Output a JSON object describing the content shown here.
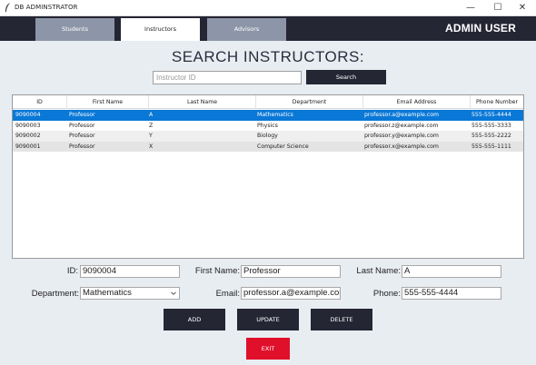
{
  "window": {
    "title": "DB ADMINSTRATOR",
    "minimize": "—",
    "maximize": "☐",
    "close": "✕"
  },
  "nav": {
    "tabs": [
      {
        "label": "Students"
      },
      {
        "label": "Instructors"
      },
      {
        "label": "Advisors"
      }
    ],
    "active_tab": "Instructors",
    "user_label": "ADMIN USER"
  },
  "search": {
    "heading": "SEARCH INSTRUCTORS:",
    "placeholder": "Instructor ID",
    "button": "Search"
  },
  "table": {
    "columns": [
      "ID",
      "First Name",
      "Last Name",
      "Department",
      "Email Address",
      "Phone Number"
    ],
    "rows": [
      [
        "9090004",
        "Professor",
        "A",
        "Mathematics",
        "professor.a@example.com",
        "555-555-4444"
      ],
      [
        "9090003",
        "Professor",
        "Z",
        "Physics",
        "professor.z@example.com",
        "555-555-3333"
      ],
      [
        "9090002",
        "Professor",
        "Y",
        "Biology",
        "professor.y@example.com",
        "555-555-2222"
      ],
      [
        "9090001",
        "Professor",
        "X",
        "Computer Science",
        "professor.x@example.com",
        "555-555-1111"
      ]
    ],
    "selected_row": 0
  },
  "form": {
    "id_label": "ID:",
    "id_value": "9090004",
    "first_name_label": "First Name:",
    "first_name_value": "Professor",
    "last_name_label": "Last Name:",
    "last_name_value": "A",
    "department_label": "Department:",
    "department_value": "Mathematics",
    "email_label": "Email:",
    "email_value": "professor.a@example.com",
    "phone_label": "Phone:",
    "phone_value": "555-555-4444"
  },
  "actions": {
    "add": "ADD",
    "update": "UPDATE",
    "delete": "DELETE",
    "exit": "EXIT"
  },
  "colors": {
    "navbar": "#252634",
    "tab_inactive": "#8d96a8",
    "selection": "#0a78d7",
    "exit": "#e0102a",
    "background": "#e8edf2"
  }
}
